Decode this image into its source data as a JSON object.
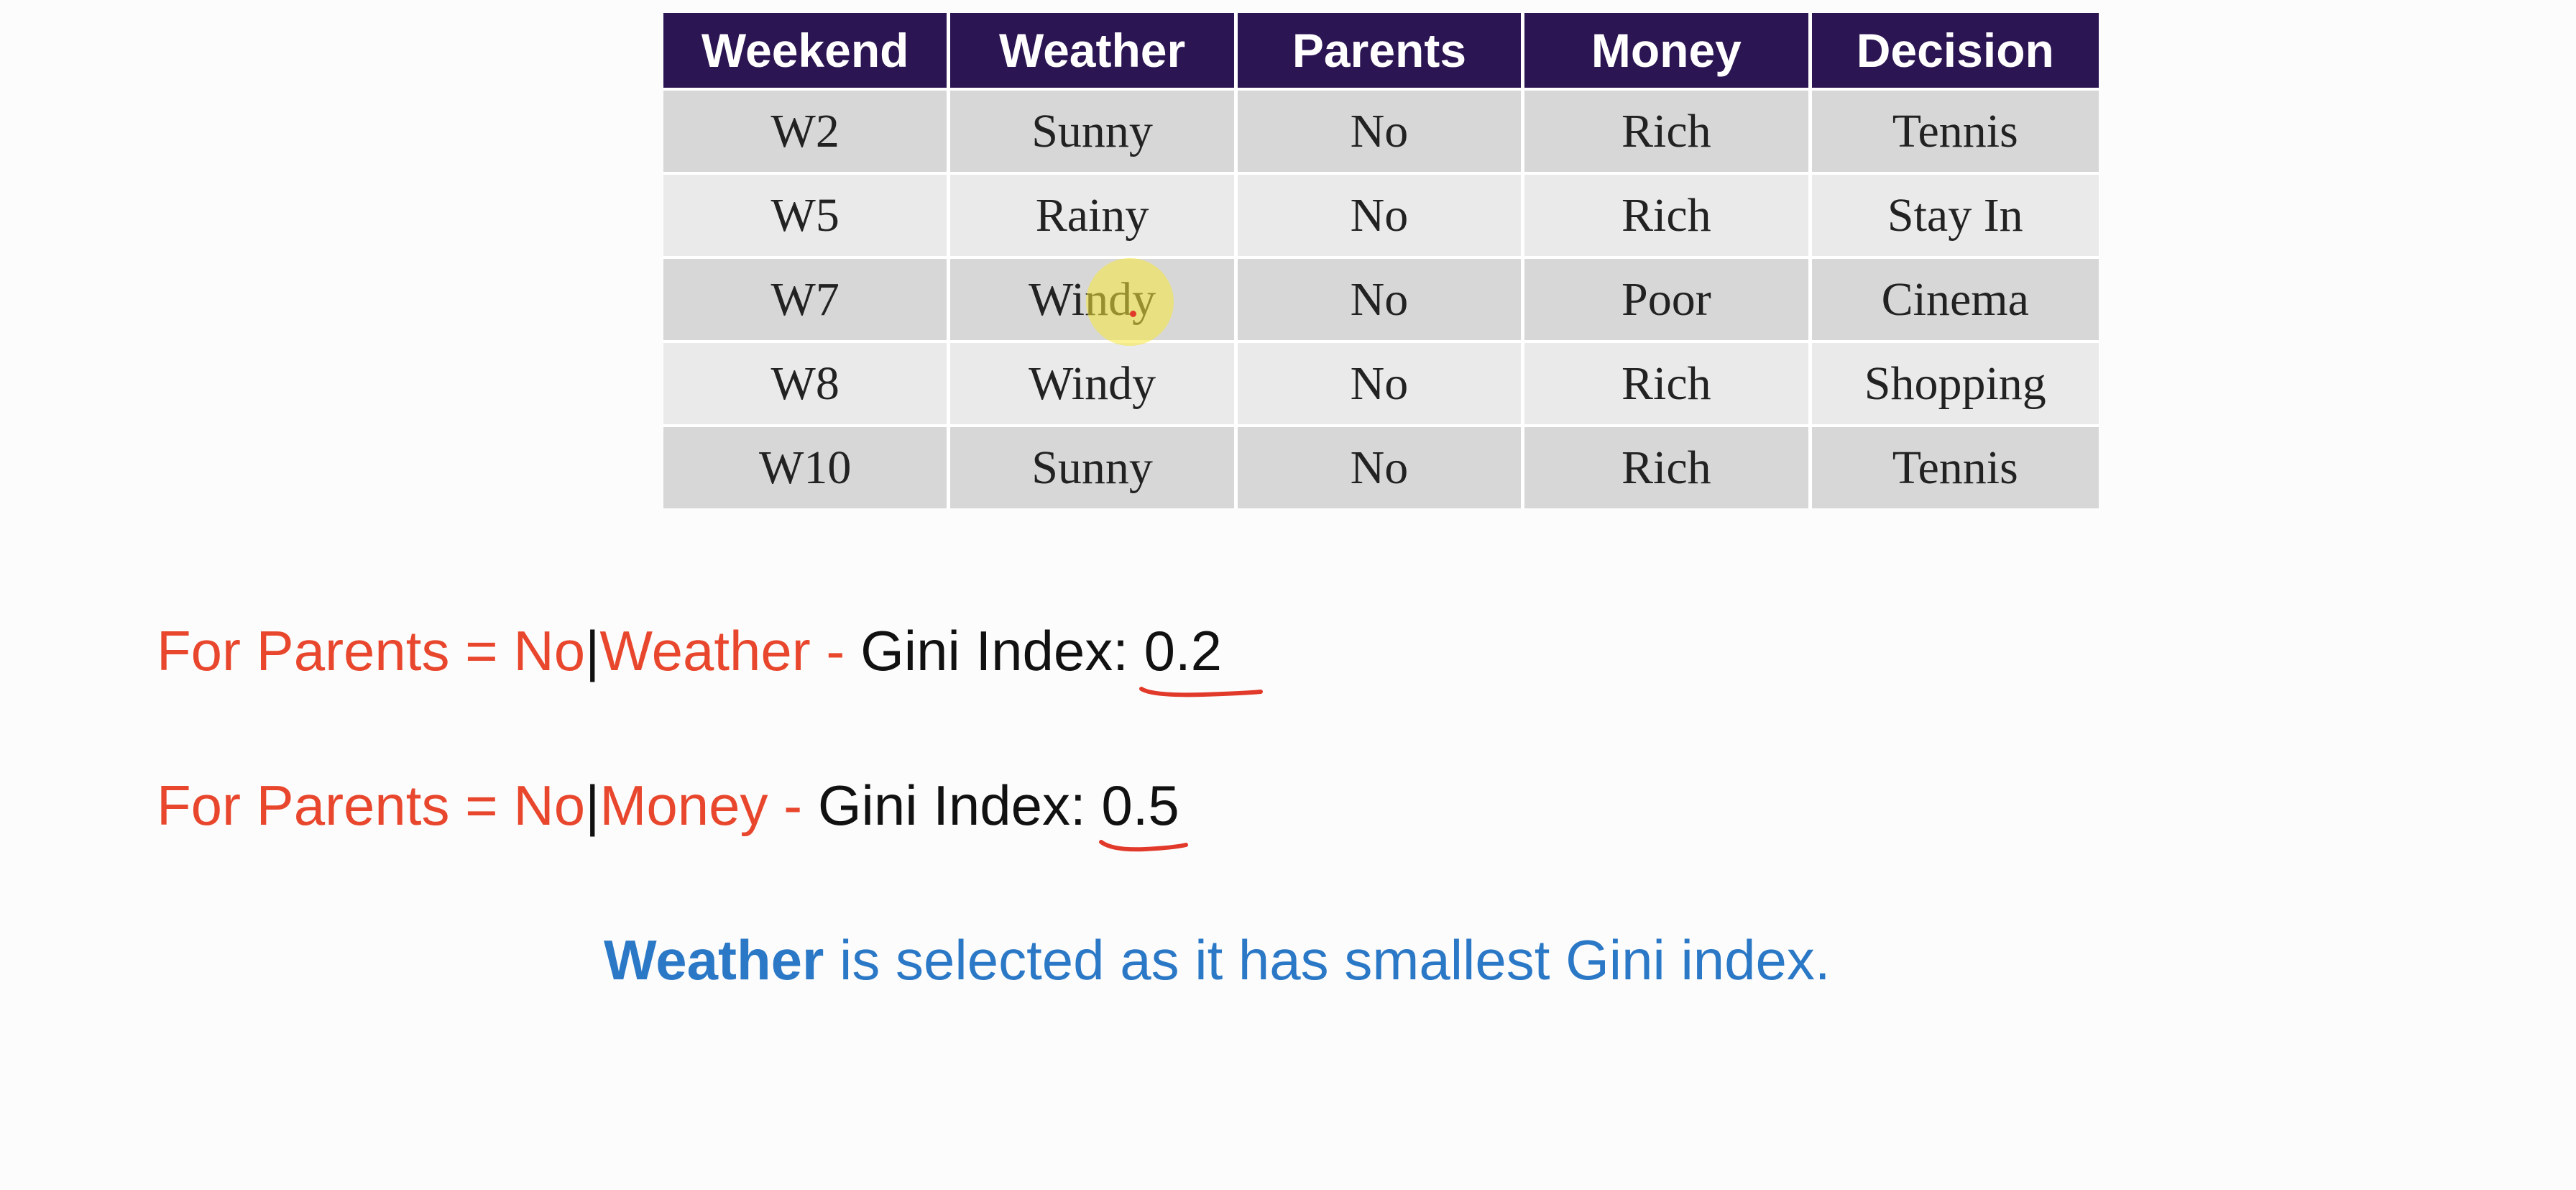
{
  "table": {
    "headers": [
      "Weekend",
      "Weather",
      "Parents",
      "Money",
      "Decision"
    ],
    "rows": [
      [
        "W2",
        "Sunny",
        "No",
        "Rich",
        "Tennis"
      ],
      [
        "W5",
        "Rainy",
        "No",
        "Rich",
        "Stay In"
      ],
      [
        "W7",
        "Windy",
        "No",
        "Poor",
        "Cinema"
      ],
      [
        "W8",
        "Windy",
        "No",
        "Rich",
        "Shopping"
      ],
      [
        "W10",
        "Sunny",
        "No",
        "Rich",
        "Tennis"
      ]
    ]
  },
  "line1": {
    "prefix": "For Parents = No",
    "pipe": "|",
    "attribute": "Weather",
    "dash": " - ",
    "label": "Gini Index: ",
    "value": "0.2"
  },
  "line2": {
    "prefix": "For Parents = No",
    "pipe": "|",
    "attribute": "Money",
    "dash": " - ",
    "label": "Gini Index: ",
    "value": "0.5"
  },
  "conclusion": {
    "bold": "Weather",
    "rest": " is selected as it has smallest Gini index."
  },
  "colors": {
    "header_bg": "#2c1553",
    "red_text": "#e8472d",
    "blue_text": "#2a78c6",
    "cursor_highlight": "#f8e83c"
  }
}
